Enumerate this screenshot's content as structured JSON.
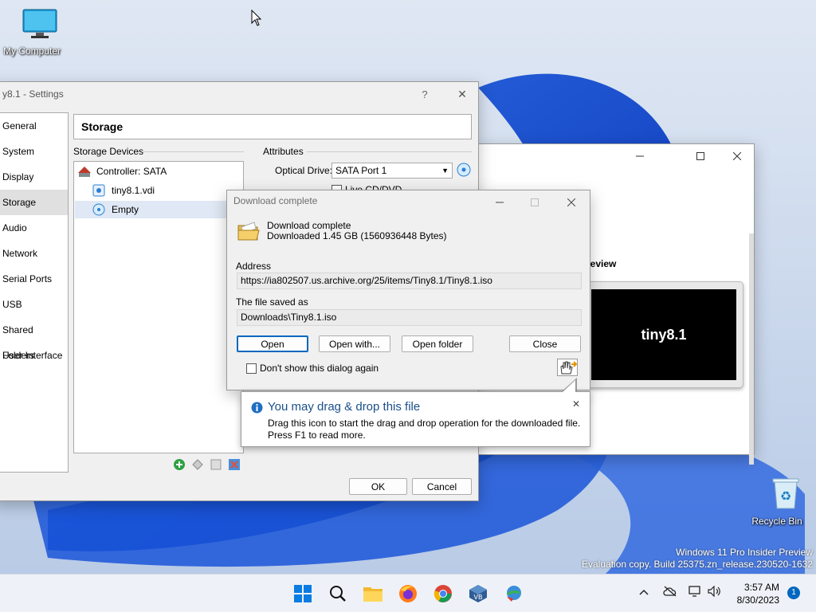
{
  "desktop": {
    "icons": [
      {
        "label": "My Computer",
        "icon": "computer-icon"
      },
      {
        "label": "Recycle Bin",
        "icon": "recycle-bin-icon"
      }
    ],
    "watermark": {
      "line1": "Windows 11 Pro Insider Preview",
      "line2": "Evaluation copy. Build 25375.zn_release.230520-1632"
    }
  },
  "vm_window": {
    "preview_label": "review",
    "preview_screen_text": "tiny8.1"
  },
  "settings": {
    "title": "y8.1 - Settings",
    "help_label": "?",
    "close_label": "✕",
    "nav": [
      {
        "label": "General"
      },
      {
        "label": "System"
      },
      {
        "label": "Display"
      },
      {
        "label": "Storage",
        "active": true
      },
      {
        "label": "Audio"
      },
      {
        "label": "Network"
      },
      {
        "label": "Serial Ports"
      },
      {
        "label": "USB"
      },
      {
        "label": "Shared Folders"
      },
      {
        "label": "User Interface"
      }
    ],
    "section_title": "Storage",
    "storage_devices_label": "Storage Devices",
    "attributes_label": "Attributes",
    "tree": {
      "controller": "Controller: SATA",
      "disk": "tiny8.1.vdi",
      "optical": "Empty"
    },
    "optical_drive_label": "Optical Drive:",
    "optical_drive_value": "SATA Port 1",
    "live_cd_label": "Live CD/DVD",
    "ok_label": "OK",
    "cancel_label": "Cancel"
  },
  "download": {
    "title": "Download complete",
    "heading": "Download complete",
    "size_text": "Downloaded 1.45  GB (1560936448 Bytes)",
    "address_label": "Address",
    "address_value": "https://ia802507.us.archive.org/25/items/Tiny8.1/Tiny8.1.iso",
    "saved_label": "The file saved as",
    "saved_value": "Downloads\\Tiny8.1.iso",
    "buttons": {
      "open": "Open",
      "open_with": "Open with...",
      "open_folder": "Open folder",
      "close": "Close"
    },
    "dont_show_label": "Don't show this dialog again"
  },
  "balloon": {
    "title": "You may drag & drop this file",
    "body": "Drag this icon to start the drag and drop operation for the downloaded file. Press F1 to read more.",
    "close": "✕"
  },
  "taskbar": {
    "apps": [
      "windows-start-icon",
      "search-icon",
      "file-explorer-icon",
      "firefox-icon",
      "chrome-icon",
      "virtualbox-icon",
      "download-manager-icon"
    ],
    "time": "3:57 AM",
    "date": "8/30/2023",
    "notification_count": "1"
  },
  "colors": {
    "accent": "#0067c0",
    "balloon_title": "#1a4f8c"
  }
}
